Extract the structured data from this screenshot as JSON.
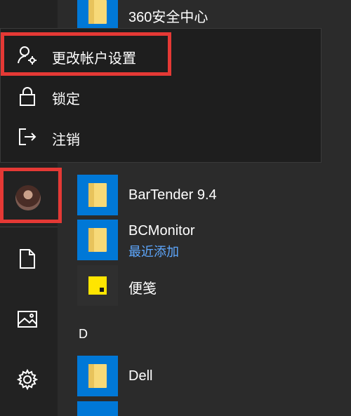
{
  "account_menu": {
    "items": [
      {
        "label": "更改帐户设置",
        "icon": "user-settings-icon"
      },
      {
        "label": "锁定",
        "icon": "lock-icon"
      },
      {
        "label": "注销",
        "icon": "sign-out-icon"
      }
    ]
  },
  "app_list": {
    "apps": [
      {
        "name": "360安全中心",
        "icon": "folder-icon"
      },
      {
        "name": "BarTender 9.4",
        "icon": "folder-icon"
      },
      {
        "name": "BCMonitor",
        "subtitle": "最近添加",
        "icon": "folder-icon"
      },
      {
        "name": "便笺",
        "icon": "sticky-notes-icon"
      },
      {
        "name": "Dell",
        "icon": "folder-icon"
      }
    ],
    "section_letters": [
      "D"
    ]
  },
  "rail": {
    "items": [
      "user-avatar",
      "documents-icon",
      "pictures-icon",
      "settings-icon"
    ]
  },
  "colors": {
    "accent": "#0078d7",
    "highlight": "#e53935",
    "recently_added": "#5ea8ff"
  }
}
